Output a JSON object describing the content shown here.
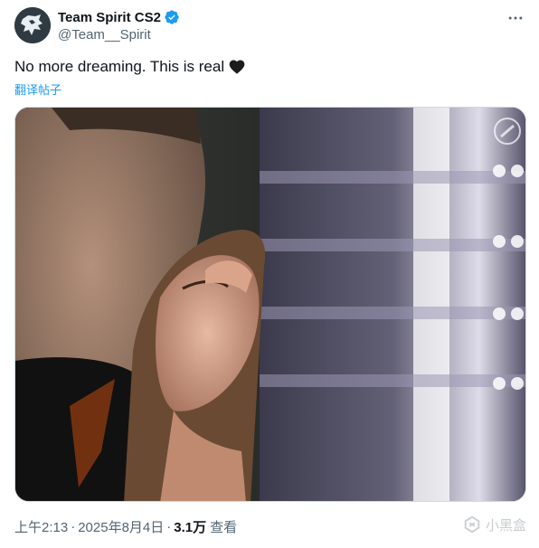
{
  "account": {
    "display_name": "Team Spirit CS2",
    "handle": "@Team__Spirit",
    "verified": true
  },
  "tweet": {
    "text": "No more dreaming. This is real",
    "emoji_name": "black-heart",
    "translate_label": "翻译帖子"
  },
  "meta": {
    "time": "上午2:13",
    "separator": "·",
    "date": "2025年8月4日",
    "views_count": "3.1万",
    "views_label": "查看"
  },
  "watermark": {
    "text": "小黑盒"
  },
  "icons": {
    "more": "more-horizontal-icon",
    "verified": "verified-badge-icon",
    "heart": "black-heart-icon",
    "logo": "team-spirit-logo",
    "watermark": "xiaoheihe-logo"
  },
  "colors": {
    "link": "#1d9bf0",
    "secondary_text": "#536471",
    "verified": "#1d9bf0"
  }
}
